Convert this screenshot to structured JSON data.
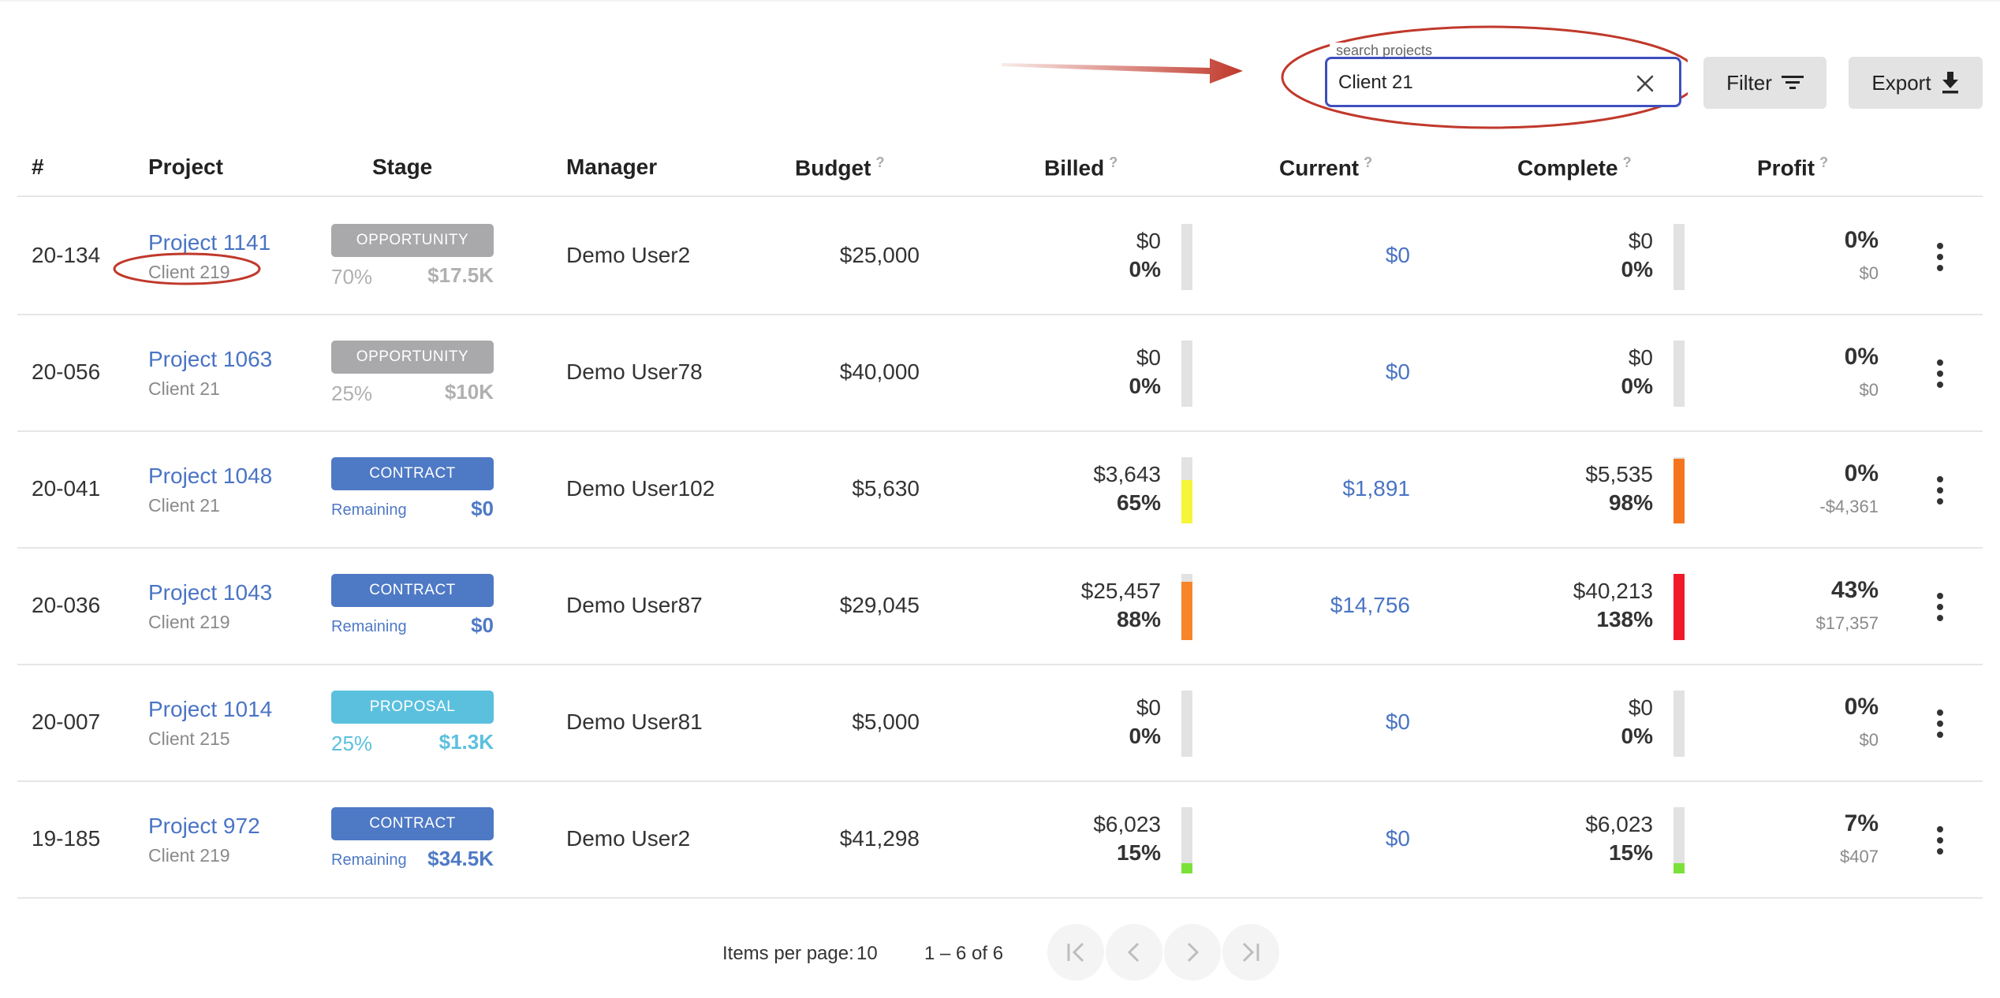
{
  "search": {
    "label": "search projects",
    "value": "Client 21"
  },
  "toolbar": {
    "filter_label": "Filter",
    "export_label": "Export"
  },
  "columns": {
    "num": "#",
    "project": "Project",
    "stage": "Stage",
    "manager": "Manager",
    "budget": "Budget",
    "billed": "Billed",
    "current": "Current",
    "complete": "Complete",
    "profit": "Profit",
    "help_glyph": "?"
  },
  "colors": {
    "opportunity": "#a9a9ab",
    "contract": "#4e79c5",
    "proposal": "#5bc0de",
    "link": "#4a74c4",
    "bar_track": "#e2e2e2",
    "yellow": "#f5f53a",
    "orange": "#f7852a",
    "red": "#f0192a",
    "green": "#7be13a",
    "deep_orange": "#f5751f"
  },
  "rows": [
    {
      "num": "20-134",
      "project": "Project 1141",
      "client": "Client 219",
      "stage": "OPPORTUNITY",
      "stage_color": "#a9a9ab",
      "stage_left": "70%",
      "stage_right": "$17.5K",
      "stage_kind": "pct",
      "manager": "Demo User2",
      "budget": "$25,000",
      "billed": "$0",
      "billed_pct": "0%",
      "billed_fill": 0,
      "billed_fill_color": "#e2e2e2",
      "current": "$0",
      "complete": "$0",
      "complete_pct": "0%",
      "complete_fill": 0,
      "complete_fill_color": "#e2e2e2",
      "profit_pct": "0%",
      "profit": "$0"
    },
    {
      "num": "20-056",
      "project": "Project 1063",
      "client": "Client 21",
      "stage": "OPPORTUNITY",
      "stage_color": "#a9a9ab",
      "stage_left": "25%",
      "stage_right": "$10K",
      "stage_kind": "pct",
      "manager": "Demo User78",
      "budget": "$40,000",
      "billed": "$0",
      "billed_pct": "0%",
      "billed_fill": 0,
      "billed_fill_color": "#e2e2e2",
      "current": "$0",
      "complete": "$0",
      "complete_pct": "0%",
      "complete_fill": 0,
      "complete_fill_color": "#e2e2e2",
      "profit_pct": "0%",
      "profit": "$0"
    },
    {
      "num": "20-041",
      "project": "Project 1048",
      "client": "Client 21",
      "stage": "CONTRACT",
      "stage_color": "#4e79c5",
      "stage_left": "Remaining",
      "stage_right": "$0",
      "stage_kind": "remaining",
      "manager": "Demo User102",
      "budget": "$5,630",
      "billed": "$3,643",
      "billed_pct": "65%",
      "billed_fill": 0.65,
      "billed_fill_color": "#f5f53a",
      "current": "$1,891",
      "complete": "$5,535",
      "complete_pct": "98%",
      "complete_fill": 0.98,
      "complete_fill_color": "#f5751f",
      "profit_pct": "0%",
      "profit": "-$4,361"
    },
    {
      "num": "20-036",
      "project": "Project 1043",
      "client": "Client 219",
      "stage": "CONTRACT",
      "stage_color": "#4e79c5",
      "stage_left": "Remaining",
      "stage_right": "$0",
      "stage_kind": "remaining",
      "manager": "Demo User87",
      "budget": "$29,045",
      "billed": "$25,457",
      "billed_pct": "88%",
      "billed_fill": 0.88,
      "billed_fill_color": "#f7852a",
      "current": "$14,756",
      "complete": "$40,213",
      "complete_pct": "138%",
      "complete_fill": 1,
      "complete_fill_color": "#f0192a",
      "profit_pct": "43%",
      "profit": "$17,357"
    },
    {
      "num": "20-007",
      "project": "Project 1014",
      "client": "Client 215",
      "stage": "PROPOSAL",
      "stage_color": "#5bc0de",
      "stage_left": "25%",
      "stage_right": "$1.3K",
      "stage_kind": "pct",
      "manager": "Demo User81",
      "budget": "$5,000",
      "billed": "$0",
      "billed_pct": "0%",
      "billed_fill": 0,
      "billed_fill_color": "#e2e2e2",
      "current": "$0",
      "complete": "$0",
      "complete_pct": "0%",
      "complete_fill": 0,
      "complete_fill_color": "#e2e2e2",
      "profit_pct": "0%",
      "profit": "$0"
    },
    {
      "num": "19-185",
      "project": "Project 972",
      "client": "Client 219",
      "stage": "CONTRACT",
      "stage_color": "#4e79c5",
      "stage_left": "Remaining",
      "stage_right": "$34.5K",
      "stage_kind": "remaining",
      "manager": "Demo User2",
      "budget": "$41,298",
      "billed": "$6,023",
      "billed_pct": "15%",
      "billed_fill": 0.15,
      "billed_fill_color": "#7be13a",
      "current": "$0",
      "complete": "$6,023",
      "complete_pct": "15%",
      "complete_fill": 0.15,
      "complete_fill_color": "#7be13a",
      "profit_pct": "7%",
      "profit": "$407"
    }
  ],
  "paginator": {
    "items_per_page_label": "Items per page:",
    "items_per_page": "10",
    "range": "1 – 6 of 6",
    "icons": [
      "first-page-icon",
      "previous-page-icon",
      "next-page-icon",
      "last-page-icon"
    ]
  }
}
